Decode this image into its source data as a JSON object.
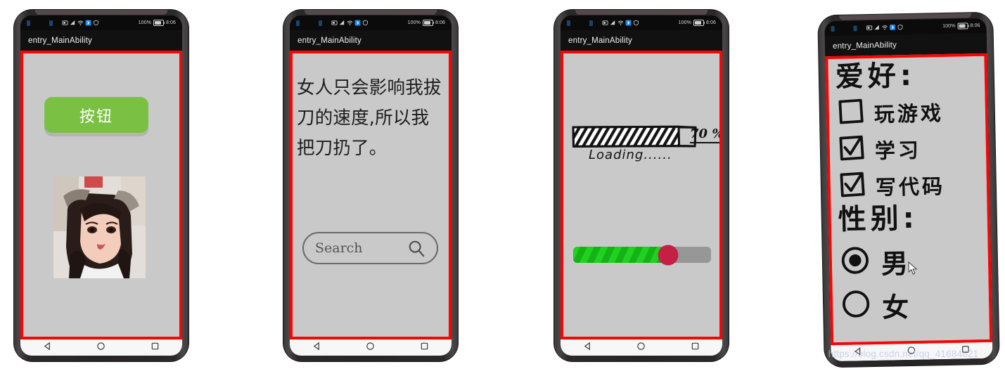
{
  "meta": {
    "description": "Four Android phone mockups showing HarmonyOS entry_MainAbility demo screens",
    "background_color": "#ffffff",
    "accent_red": "#fb0404",
    "app_background": "#c9c9c9"
  },
  "status_bar": {
    "battery_percent": "100%",
    "time": "8:06",
    "icons": [
      "sim-card-icon",
      "signal-bars-icon",
      "wifi-icon",
      "bluetooth-icon",
      "shield-icon"
    ]
  },
  "nav_bar": {
    "back": "back-triangle-icon",
    "home": "home-circle-icon",
    "recents": "recents-square-icon"
  },
  "title_bar": {
    "title": "entry_MainAbility"
  },
  "phones": [
    {
      "index": 1,
      "name": "button-and-image-screen",
      "button": {
        "label": "按钮",
        "color": "#7ac143",
        "text_color": "#ffffff"
      },
      "image": {
        "alt": "portrait-photo"
      }
    },
    {
      "index": 2,
      "name": "text-and-search-screen",
      "paragraph": "女人只会影响我拔刀的速度,所以我把刀扔了。",
      "search": {
        "placeholder": "Search",
        "value": "",
        "icon": "search-icon"
      }
    },
    {
      "index": 3,
      "name": "progress-and-slider-screen",
      "progress": {
        "percent_label": "70 %",
        "value": 70,
        "max": 100,
        "caption": "Loading......"
      },
      "slider": {
        "value": 69,
        "max": 100,
        "fill_color": "#1fd21f",
        "track_color": "#979797",
        "thumb_color": "#c41f45"
      }
    },
    {
      "index": 4,
      "name": "checkbox-and-radio-screen",
      "checkbox_group": {
        "legend": "爱好:",
        "options": [
          {
            "label": "玩游戏",
            "checked": false
          },
          {
            "label": "学习",
            "checked": true
          },
          {
            "label": "写代码",
            "checked": true
          }
        ]
      },
      "radio_group": {
        "legend": "性别:",
        "options": [
          {
            "label": "男",
            "selected": true
          },
          {
            "label": "女",
            "selected": false
          }
        ]
      },
      "watermark": "https://blog.csdn.net/qq_41684621"
    }
  ]
}
